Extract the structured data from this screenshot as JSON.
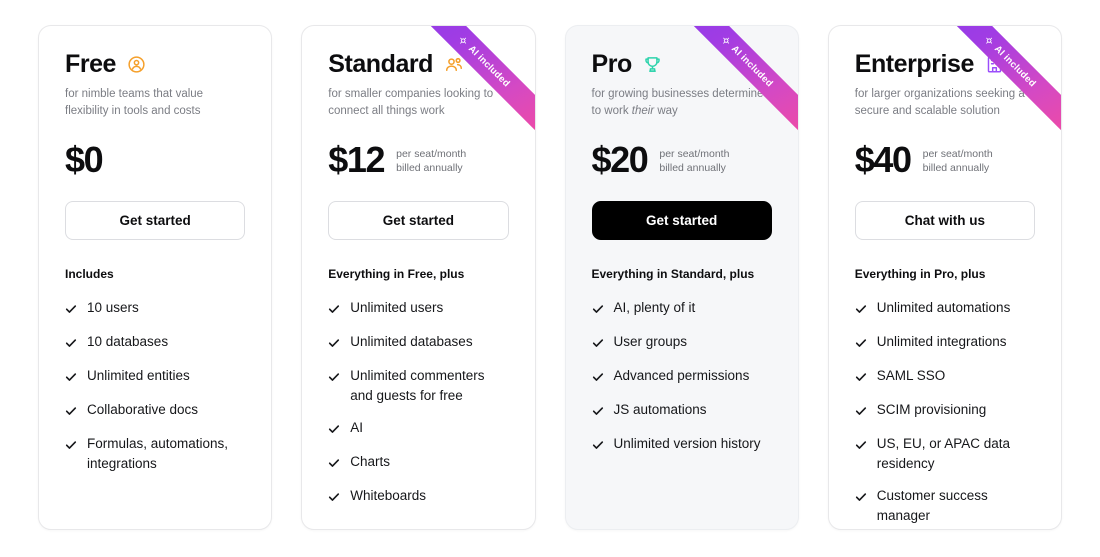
{
  "ribbon": {
    "label": "AI included",
    "icon": "sparkle-icon",
    "gradient_from": "#8b3dea",
    "gradient_to": "#ef4ba4"
  },
  "icons": {
    "check": "check-icon"
  },
  "plans": [
    {
      "name": "Free",
      "icon": "person-circle-icon",
      "icon_color": "#f5a02c",
      "tagline": "for nimble teams that value flexibility in tools and costs",
      "price": "$0",
      "price_meta": "",
      "cta_label": "Get started",
      "cta_style": "outline",
      "ribbon": false,
      "highlighted": false,
      "features_title": "Includes",
      "features": [
        "10 users",
        "10 databases",
        "Unlimited entities",
        "Collaborative docs",
        "Formulas, automations, integrations"
      ]
    },
    {
      "name": "Standard",
      "icon": "people-group-icon",
      "icon_color": "#f5a02c",
      "tagline": "for smaller companies looking to connect all things work",
      "price": "$12",
      "price_meta_line1": "per seat/month",
      "price_meta_line2": "billed annually",
      "cta_label": "Get started",
      "cta_style": "outline",
      "ribbon": true,
      "highlighted": false,
      "features_title": "Everything in Free, plus",
      "features": [
        "Unlimited users",
        "Unlimited databases",
        "Unlimited commenters and guests for free",
        "AI",
        "Charts",
        "Whiteboards"
      ]
    },
    {
      "name": "Pro",
      "icon": "trophy-icon",
      "icon_color": "#2ed3ac",
      "tagline_pre": "for growing businesses determined to work ",
      "tagline_em": "their",
      "tagline_post": " way",
      "price": "$20",
      "price_meta_line1": "per seat/month",
      "price_meta_line2": "billed annually",
      "cta_label": "Get started",
      "cta_style": "primary",
      "ribbon": true,
      "highlighted": true,
      "features_title": "Everything in Standard, plus",
      "features": [
        "AI, plenty of it",
        "User groups",
        "Advanced permissions",
        "JS automations",
        "Unlimited version history"
      ]
    },
    {
      "name": "Enterprise",
      "icon": "building-icon",
      "icon_color": "#9b4dfb",
      "tagline": "for larger organizations seeking a secure and scalable solution",
      "price": "$40",
      "price_meta_line1": "per seat/month",
      "price_meta_line2": "billed annually",
      "cta_label": "Chat with us",
      "cta_style": "outline",
      "ribbon": true,
      "highlighted": false,
      "features_title": "Everything in Pro, plus",
      "features": [
        "Unlimited automations",
        "Unlimited integrations",
        "SAML SSO",
        "SCIM provisioning",
        "US, EU, or APAC data residency",
        "Customer success manager"
      ]
    }
  ]
}
